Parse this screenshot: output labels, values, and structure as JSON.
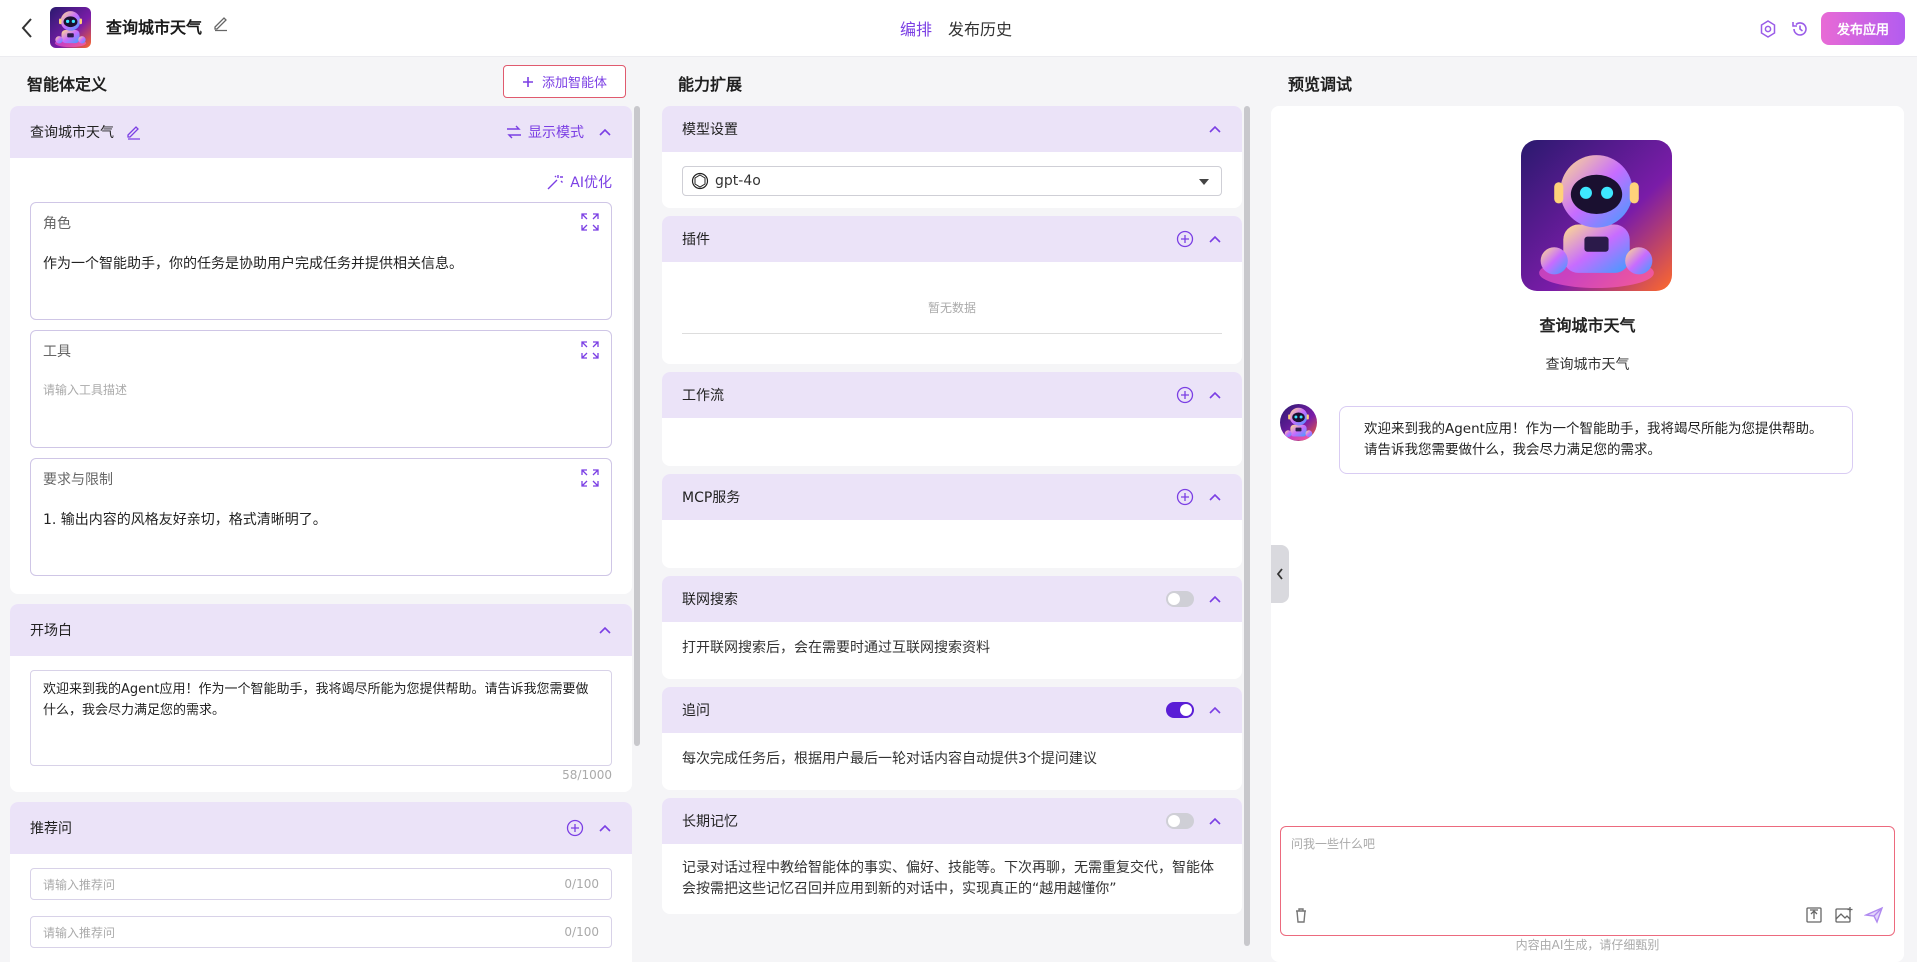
{
  "header": {
    "app_title": "查询城市天气",
    "tabs": [
      {
        "label": "编排",
        "active": true
      },
      {
        "label": "发布历史",
        "active": false
      }
    ],
    "publish_label": "发布应用",
    "accent_color": "#7b3fe4"
  },
  "left": {
    "section_title": "智能体定义",
    "add_agent_label": "添加智能体",
    "agent_card": {
      "name": "查询城市天气",
      "display_mode_label": "显示模式",
      "ai_optimize_label": "AI优化",
      "role": {
        "label": "角色",
        "value": "作为一个智能助手，你的任务是协助用户完成任务并提供相关信息。"
      },
      "tools": {
        "label": "工具",
        "placeholder": "请输入工具描述"
      },
      "constraints": {
        "label": "要求与限制",
        "value": "1. 输出内容的风格友好亲切，格式清晰明了。"
      }
    },
    "opening": {
      "label": "开场白",
      "value": "欢迎来到我的Agent应用！作为一个智能助手，我将竭尽所能为您提供帮助。请告诉我您需要做什么，我会尽力满足您的需求。",
      "counter": "58/1000"
    },
    "suggested": {
      "label": "推荐问",
      "items": [
        {
          "placeholder": "请输入推荐问",
          "counter": "0/100"
        },
        {
          "placeholder": "请输入推荐问",
          "counter": "0/100"
        }
      ]
    }
  },
  "middle": {
    "section_title": "能力扩展",
    "model": {
      "label": "模型设置",
      "selected": "gpt-4o"
    },
    "plugins": {
      "label": "插件",
      "empty": "暂无数据"
    },
    "workflow": {
      "label": "工作流"
    },
    "mcp": {
      "label": "MCP服务"
    },
    "web_search": {
      "label": "联网搜索",
      "enabled": false,
      "desc": "打开联网搜索后，会在需要时通过互联网搜索资料"
    },
    "follow_up": {
      "label": "追问",
      "enabled": true,
      "desc": "每次完成任务后，根据用户最后一轮对话内容自动提供3个提问建议"
    },
    "memory": {
      "label": "长期记忆",
      "enabled": false,
      "desc": "记录对话过程中教给智能体的事实、偏好、技能等。下次再聊，无需重复交代，智能体会按需把这些记忆召回并应用到新的对话中，实现真正的“越用越懂你”"
    }
  },
  "right": {
    "section_title": "预览调试",
    "agent_name": "查询城市天气",
    "agent_desc": "查询城市天气",
    "welcome_message": "欢迎来到我的Agent应用！作为一个智能助手，我将竭尽所能为您提供帮助。请告诉我您需要做什么，我会尽力满足您的需求。",
    "input_placeholder": "问我一些什么吧",
    "disclaimer": "内容由AI生成，请仔细甄别"
  }
}
